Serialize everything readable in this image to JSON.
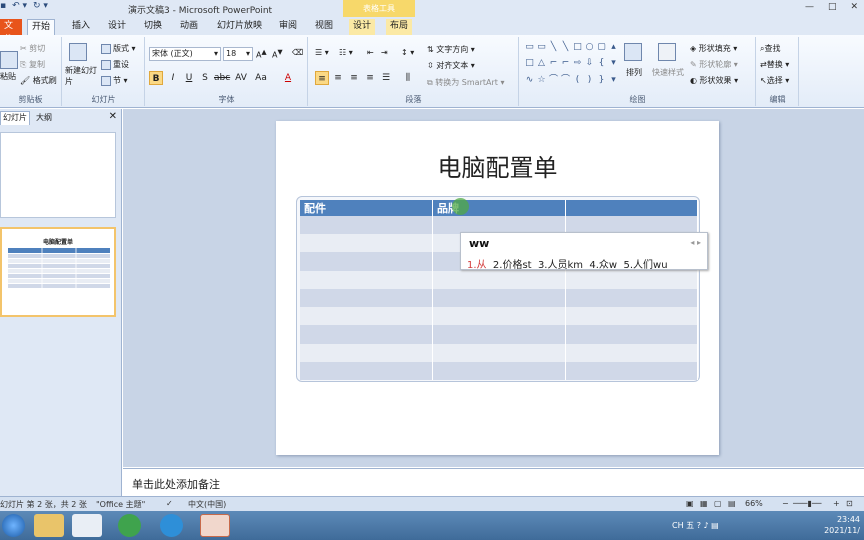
{
  "titlebar": {
    "title": "演示文稿3 - Microsoft PowerPoint",
    "context_group": "表格工具",
    "min": "—",
    "max": "□",
    "close": "✕"
  },
  "tabs": {
    "file": "文件",
    "home": "开始",
    "insert": "插入",
    "design": "设计",
    "transitions": "切换",
    "animations": "动画",
    "slideshow": "幻灯片放映",
    "review": "审阅",
    "view": "视图",
    "table_design": "设计",
    "table_layout": "布局"
  },
  "ribbon": {
    "clipboard": {
      "label": "剪贴板",
      "paste": "粘贴",
      "cut": "剪切",
      "copy": "复制",
      "format_painter": "格式刷"
    },
    "slides": {
      "label": "幻灯片",
      "new_slide": "新建幻灯片",
      "layout": "版式",
      "reset": "重设",
      "section": "节"
    },
    "font": {
      "label": "字体",
      "font_name": "宋体 (正文)",
      "font_size": "18"
    },
    "paragraph": {
      "label": "段落",
      "text_direction": "文字方向",
      "align_text": "对齐文本",
      "smartart": "转换为 SmartArt"
    },
    "drawing": {
      "label": "绘图",
      "arrange": "排列",
      "quick_styles": "快速样式",
      "fill": "形状填充",
      "outline": "形状轮廓",
      "effects": "形状效果"
    },
    "editing": {
      "label": "编辑",
      "find": "查找",
      "replace": "替换",
      "select": "选择"
    }
  },
  "left_panel": {
    "tab_slides": "幻灯片",
    "tab_outline": "大纲",
    "thumb2_title": "电脑配置单"
  },
  "slide": {
    "title": "电脑配置单",
    "table_headers": [
      "配件",
      "品牌",
      ""
    ],
    "body_rows": 9
  },
  "ime": {
    "composition": "ww",
    "candidates": [
      "1.从",
      "2.价格st",
      "3.人员km",
      "4.众w",
      "5.人们wu"
    ]
  },
  "notes": {
    "placeholder": "单击此处添加备注"
  },
  "statusbar": {
    "slide_info": "幻灯片 第 2 张，共 2 张",
    "theme": "\"Office 主题\"",
    "language": "中文(中国)",
    "zoom": "66%"
  },
  "taskbar": {
    "time": "23:44",
    "date": "2021/11/",
    "tray_ime": "CH",
    "tray_lang": "五"
  }
}
